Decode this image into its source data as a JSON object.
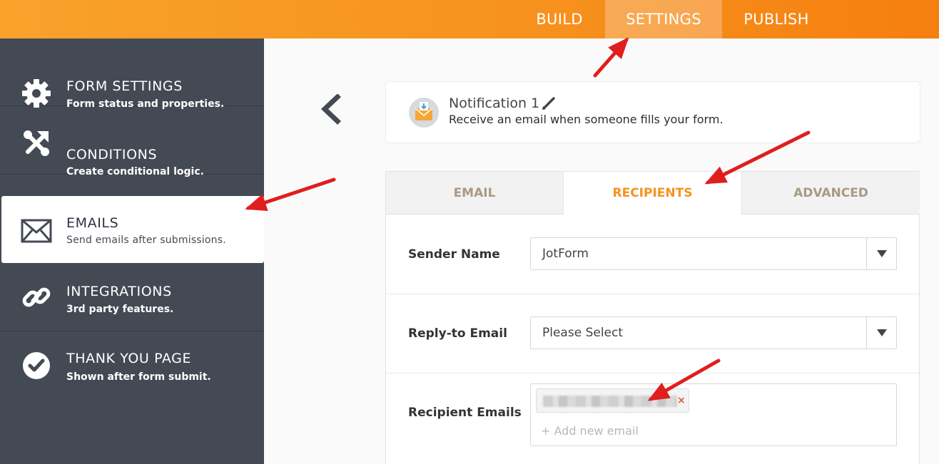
{
  "topnav": {
    "build": "BUILD",
    "settings": "SETTINGS",
    "publish": "PUBLISH"
  },
  "sidebar": {
    "items": [
      {
        "title": "FORM SETTINGS",
        "subtitle": "Form status and properties.",
        "icon": "gear-icon"
      },
      {
        "title": "CONDITIONS",
        "subtitle": "Create conditional logic.",
        "icon": "conditions-icon"
      },
      {
        "title": "EMAILS",
        "subtitle": "Send emails after submissions.",
        "icon": "envelope-icon"
      },
      {
        "title": "INTEGRATIONS",
        "subtitle": "3rd party features.",
        "icon": "link-icon"
      },
      {
        "title": "THANK YOU PAGE",
        "subtitle": "Shown after form submit.",
        "icon": "check-circle-icon"
      }
    ],
    "active_index": 2
  },
  "notification": {
    "title": "Notification 1",
    "description": "Receive an email when someone fills your form."
  },
  "tabs": {
    "email": "EMAIL",
    "recipients": "RECIPIENTS",
    "advanced": "ADVANCED",
    "active": "RECIPIENTS"
  },
  "form": {
    "sender_name": {
      "label": "Sender Name",
      "value": "JotForm"
    },
    "reply_to": {
      "label": "Reply-to Email",
      "value": "Please Select"
    },
    "recipients": {
      "label": "Recipient Emails",
      "email": "█████████████",
      "remove": "×",
      "add_placeholder": "+ Add new email"
    }
  },
  "colors": {
    "accent": "#f7921e",
    "sidebar": "#444a54",
    "annotation": "#e01e1e"
  }
}
